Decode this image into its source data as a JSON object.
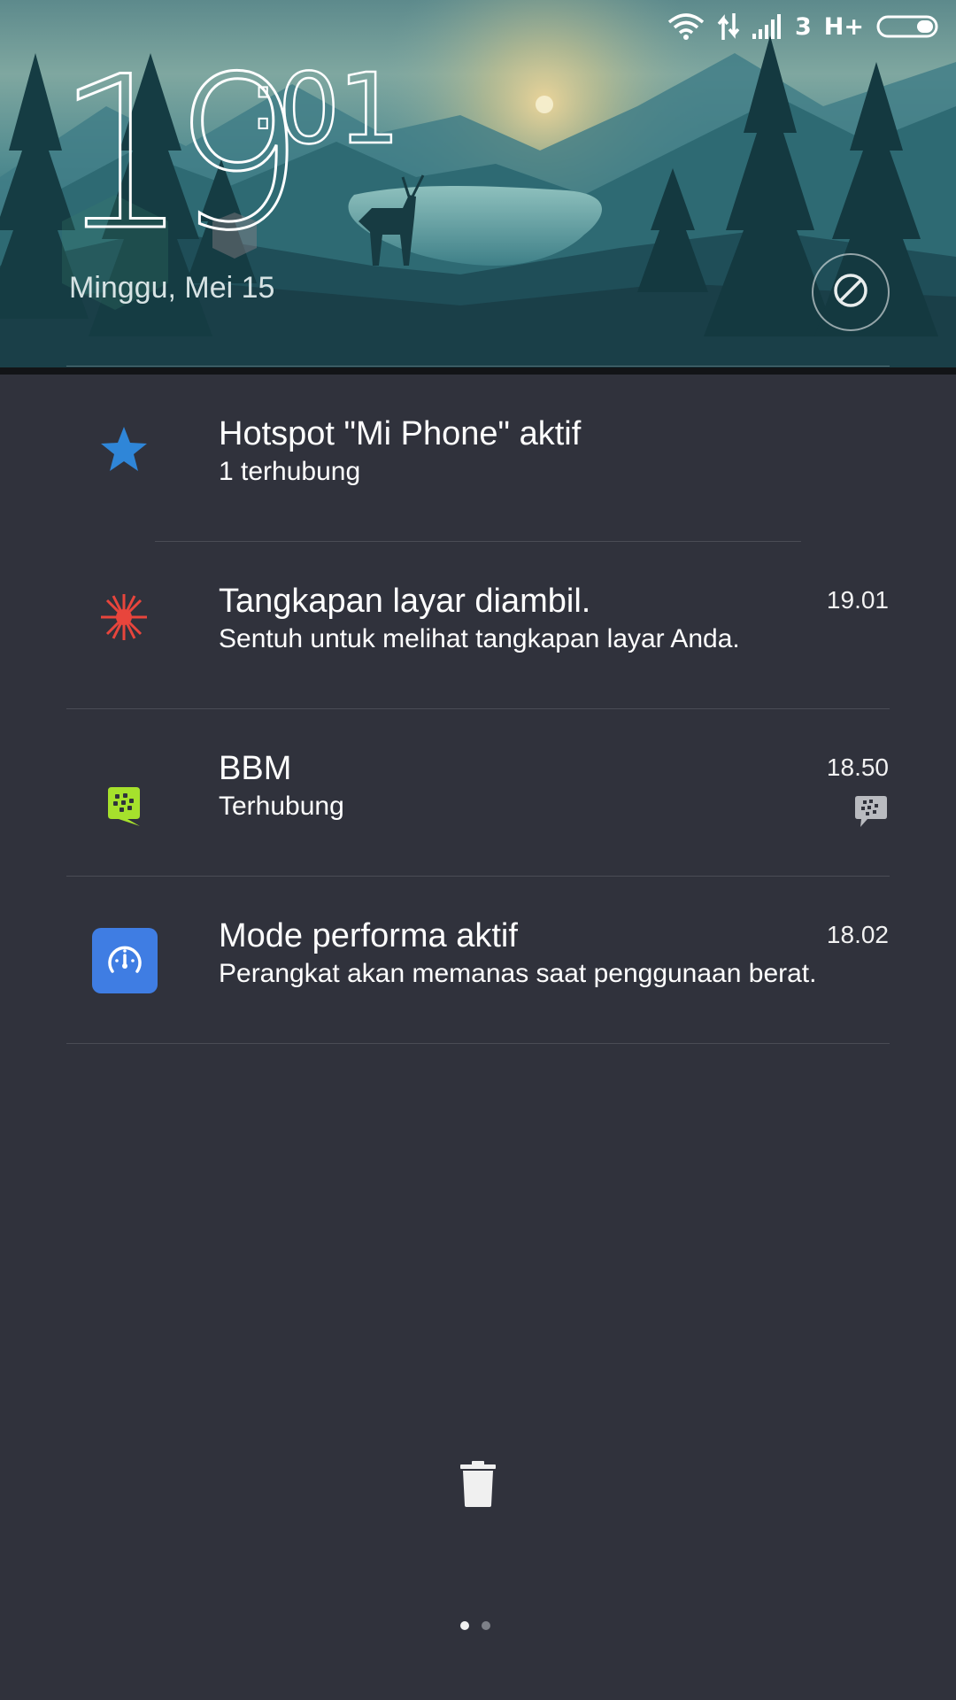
{
  "status_bar": {
    "sim_label": "3",
    "network_type": "H+",
    "icons": [
      "wifi-icon",
      "data-transfer-icon",
      "signal-icon",
      "battery-icon"
    ]
  },
  "lockscreen": {
    "clock_hours": "19",
    "clock_minutes": "01",
    "clock_separator": ":",
    "date": "Minggu, Mei 15",
    "dnd_icon": "do-not-disturb-icon"
  },
  "notifications": [
    {
      "title": "Hotspot \"Mi Phone\" aktif",
      "subtitle": "1 terhubung",
      "time": "",
      "icon": "star-icon",
      "icon_color": "#2f86d8"
    },
    {
      "title": "Tangkapan layar diambil.",
      "subtitle": "Sentuh untuk melihat tangkapan layar Anda.",
      "time": "19.01",
      "icon": "screenshot-burst-icon",
      "icon_color": "#e8453c"
    },
    {
      "title": "BBM",
      "subtitle": "Terhubung",
      "time": "18.50",
      "icon": "bbm-icon",
      "icon_color": "#a6e12c",
      "small_icon": "bbm-chat-icon"
    },
    {
      "title": "Mode performa aktif",
      "subtitle": "Perangkat akan memanas saat penggunaan berat.",
      "time": "18.02",
      "icon": "speedometer-icon",
      "icon_color": "#3f7de3"
    }
  ],
  "bottom": {
    "clear_icon": "trash-icon",
    "pages": 2,
    "active_page": 1
  },
  "colors": {
    "panel_background": "#30323c",
    "text": "#ffffff"
  }
}
